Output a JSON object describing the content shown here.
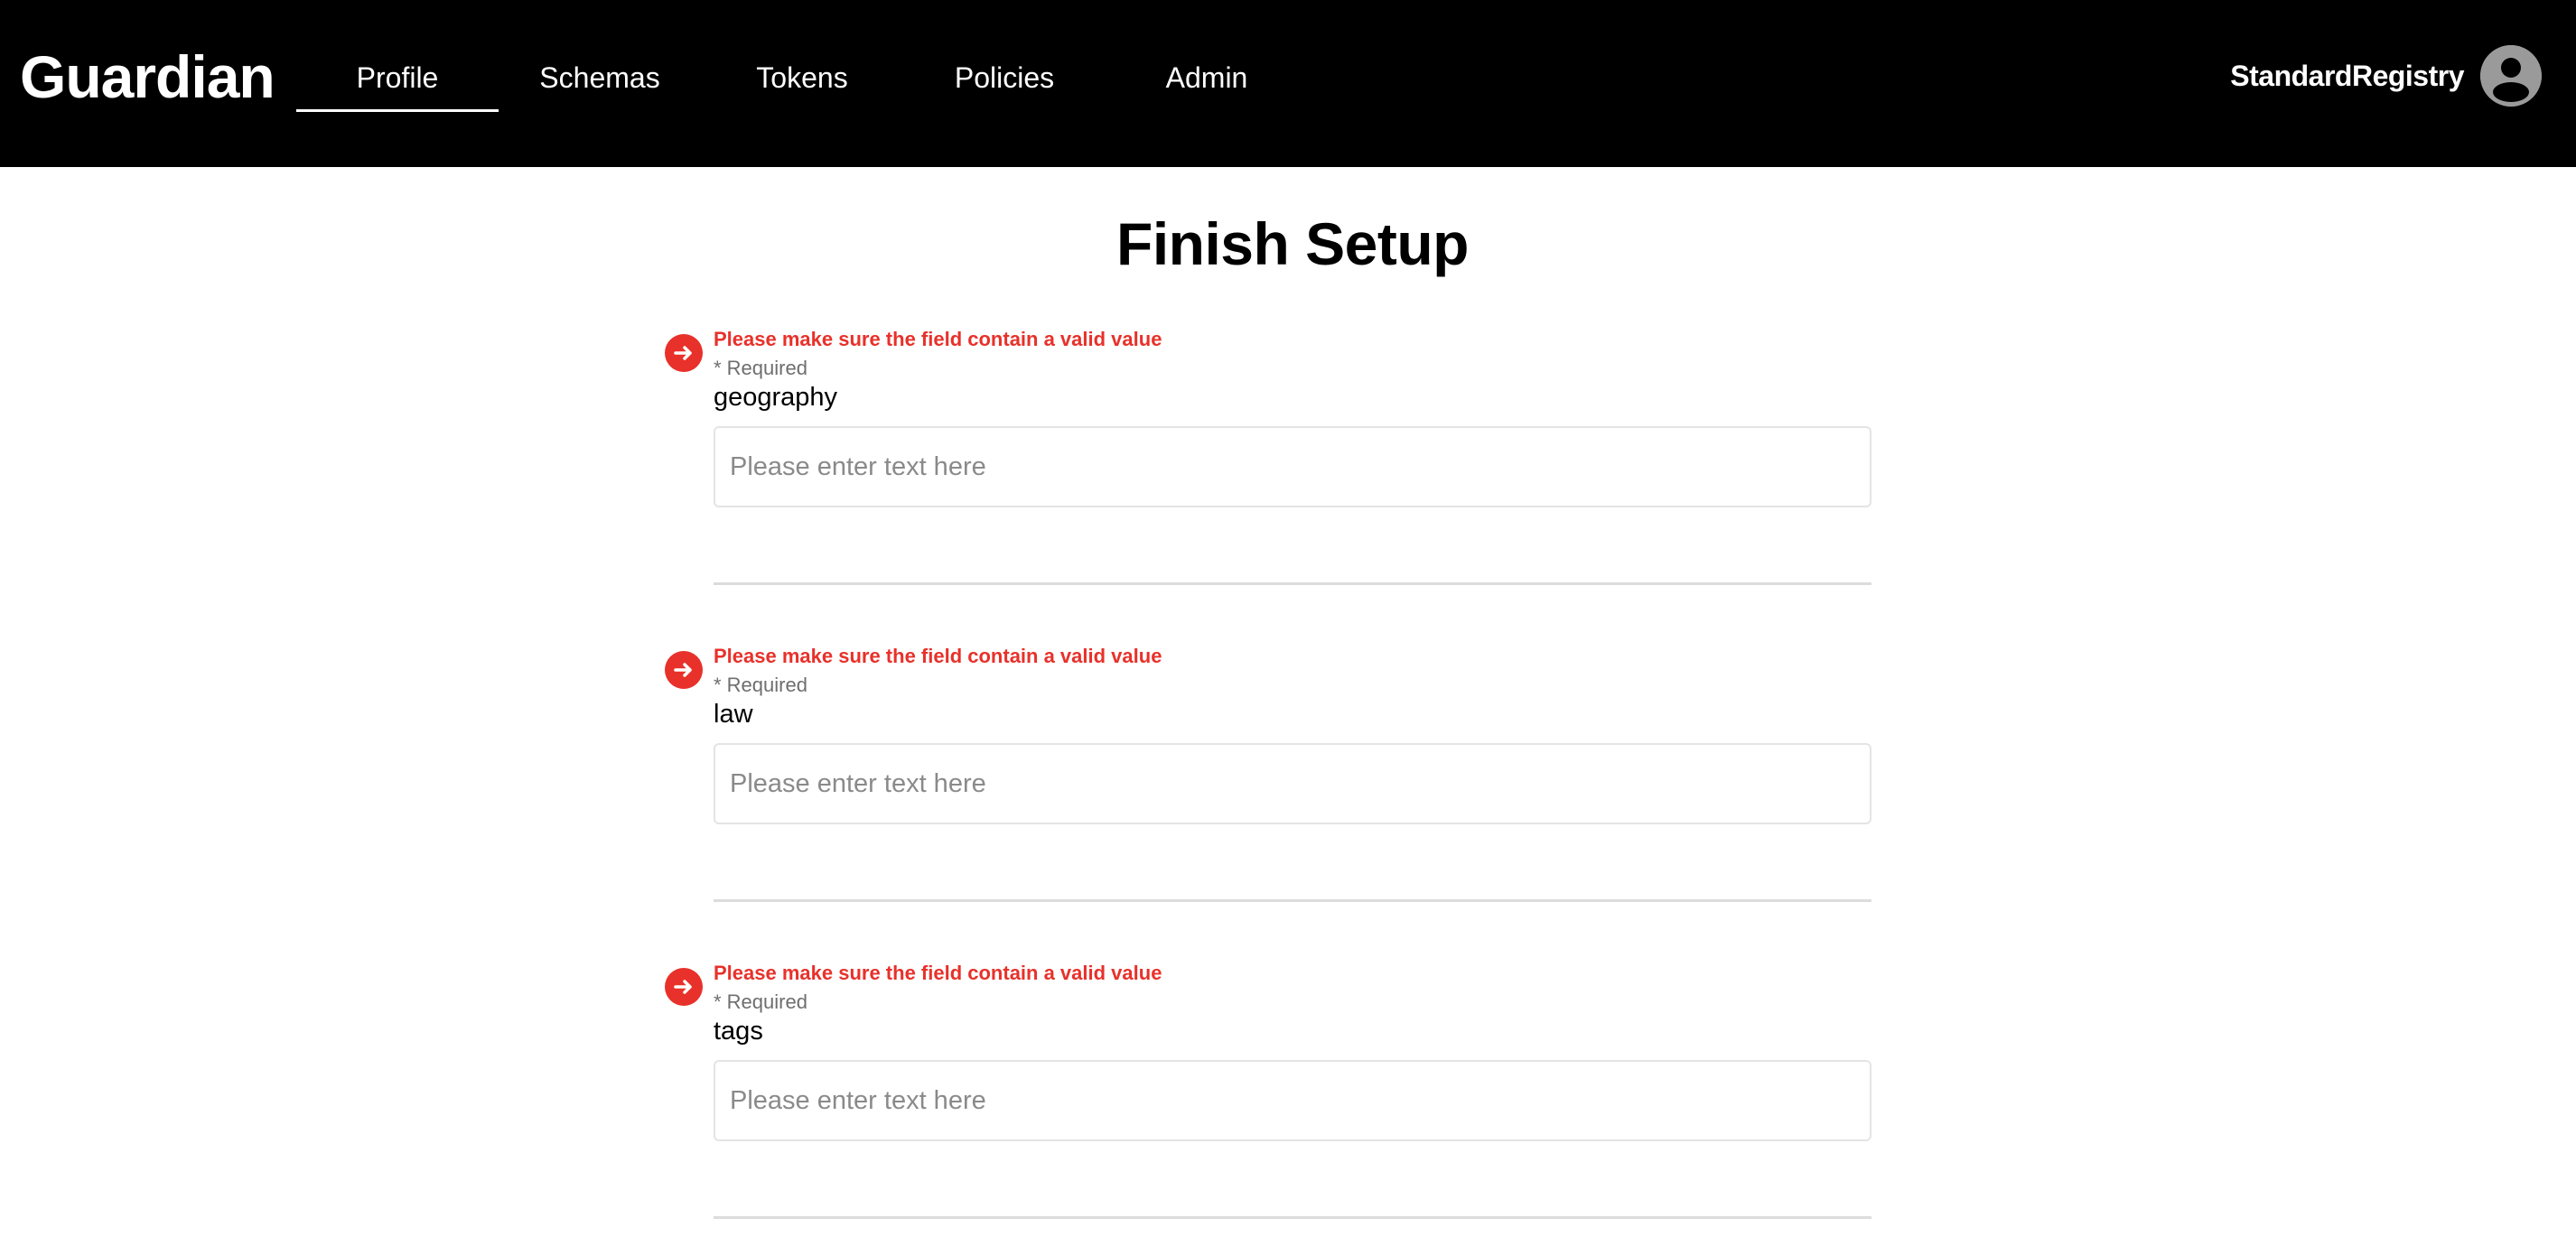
{
  "app": {
    "brand": "Guardian",
    "nav": [
      {
        "label": "Profile",
        "active": true
      },
      {
        "label": "Schemas",
        "active": false
      },
      {
        "label": "Tokens",
        "active": false
      },
      {
        "label": "Policies",
        "active": false
      },
      {
        "label": "Admin",
        "active": false
      }
    ],
    "user": {
      "name": "StandardRegistry",
      "avatar_icon": "user-circle-icon"
    }
  },
  "page": {
    "title": "Finish Setup"
  },
  "form": {
    "fields": [
      {
        "error": "Please make sure the field contain a valid value",
        "required": "* Required",
        "label": "geography",
        "placeholder": "Please enter text here",
        "value": ""
      },
      {
        "error": "Please make sure the field contain a valid value",
        "required": "* Required",
        "label": "law",
        "placeholder": "Please enter text here",
        "value": ""
      },
      {
        "error": "Please make sure the field contain a valid value",
        "required": "* Required",
        "label": "tags",
        "placeholder": "Please enter text here",
        "value": ""
      }
    ]
  },
  "colors": {
    "topbar_bg": "#000000",
    "error": "#e8312a",
    "input_border": "#e4e4e4",
    "divider": "#dcdcdc"
  }
}
